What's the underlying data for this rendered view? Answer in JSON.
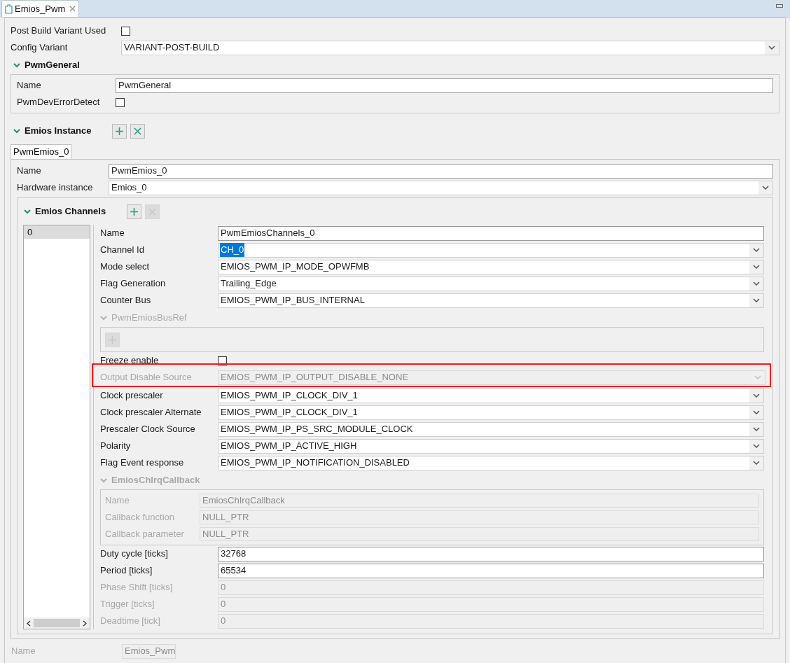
{
  "editor_tab": {
    "title": "Emios_Pwm",
    "selected": true
  },
  "top_fields": [
    {
      "kind": "check",
      "label": "Post Build Variant Used",
      "checked": false
    },
    {
      "kind": "combo",
      "label": "Config Variant",
      "value": "VARIANT-POST-BUILD"
    }
  ],
  "pwm_general": {
    "title": "PwmGeneral",
    "fields": [
      {
        "kind": "text",
        "label": "Name",
        "value": "PwmGeneral"
      },
      {
        "kind": "check",
        "label": "PwmDevErrorDetect",
        "checked": false
      }
    ]
  },
  "emios_instance": {
    "title": "Emios Instance",
    "buttons": [
      {
        "kind": "add",
        "disabled": false
      },
      {
        "kind": "remove",
        "disabled": false
      }
    ],
    "tabs": [
      {
        "label": "PwmEmios_0",
        "selected": true
      }
    ],
    "fields": [
      {
        "kind": "text",
        "label": "Name",
        "value": "PwmEmios_0"
      },
      {
        "kind": "combo",
        "label": "Hardware instance",
        "value": "Emios_0"
      }
    ]
  },
  "emios_channels": {
    "title": "Emios Channels",
    "buttons": [
      {
        "kind": "add",
        "disabled": false
      },
      {
        "kind": "remove",
        "disabled": true
      }
    ],
    "list": [
      {
        "label": "0",
        "selected": true
      }
    ],
    "fields": [
      {
        "kind": "text",
        "label": "Name",
        "value": "PwmEmiosChannels_0",
        "disabled": false
      },
      {
        "kind": "combo",
        "label": "Channel Id",
        "value": "CH_0",
        "value_selected": true,
        "disabled": false
      },
      {
        "kind": "combo",
        "label": "Mode select",
        "value": "EMIOS_PWM_IP_MODE_OPWFMB",
        "disabled": false
      },
      {
        "kind": "combo",
        "label": "Flag Generation",
        "value": "Trailing_Edge",
        "disabled": false
      },
      {
        "kind": "combo",
        "label": "Counter Bus",
        "value": "EMIOS_PWM_IP_BUS_INTERNAL",
        "disabled": false
      },
      {
        "kind": "group",
        "label": "PwmEmiosBusRef",
        "disabled": true,
        "buttons": [
          {
            "kind": "add",
            "disabled": true
          }
        ]
      },
      {
        "kind": "check",
        "label": "Freeze enable",
        "checked": false,
        "disabled": false
      },
      {
        "kind": "combo",
        "label": "Output Disable Source",
        "value": "EMIOS_PWM_IP_OUTPUT_DISABLE_NONE",
        "disabled": true,
        "highlighted": true
      },
      {
        "kind": "combo",
        "label": "Clock prescaler",
        "value": "EMIOS_PWM_IP_CLOCK_DIV_1",
        "disabled": false
      },
      {
        "kind": "combo",
        "label": "Clock prescaler Alternate",
        "value": "EMIOS_PWM_IP_CLOCK_DIV_1",
        "disabled": false
      },
      {
        "kind": "combo",
        "label": "Prescaler Clock Source",
        "value": "EMIOS_PWM_IP_PS_SRC_MODULE_CLOCK",
        "disabled": false
      },
      {
        "kind": "combo",
        "label": "Polarity",
        "value": "EMIOS_PWM_IP_ACTIVE_HIGH",
        "disabled": false
      },
      {
        "kind": "combo",
        "label": "Flag Event response",
        "value": "EMIOS_PWM_IP_NOTIFICATION_DISABLED",
        "disabled": false
      },
      {
        "kind": "group",
        "label": "EmiosChIrqCallback",
        "disabled": true,
        "fields": [
          {
            "kind": "text",
            "label": "Name",
            "value": "EmiosChIrqCallback",
            "disabled": true
          },
          {
            "kind": "text",
            "label": "Callback function",
            "value": "NULL_PTR",
            "disabled": true
          },
          {
            "kind": "text",
            "label": "Callback parameter",
            "value": "NULL_PTR",
            "disabled": true
          }
        ]
      },
      {
        "kind": "text",
        "label": "Duty cycle [ticks]",
        "value": "32768",
        "disabled": false
      },
      {
        "kind": "text",
        "label": "Period [ticks]",
        "value": "65534",
        "disabled": false
      },
      {
        "kind": "text",
        "label": "Phase Shift [ticks]",
        "value": "0",
        "disabled": true
      },
      {
        "kind": "text",
        "label": "Trigger [ticks]",
        "value": "0",
        "disabled": true
      },
      {
        "kind": "text",
        "label": "Deadtime [tick]",
        "value": "0",
        "disabled": true
      }
    ]
  },
  "footer": {
    "label": "Name",
    "value": "Emios_Pwm",
    "disabled": true
  }
}
